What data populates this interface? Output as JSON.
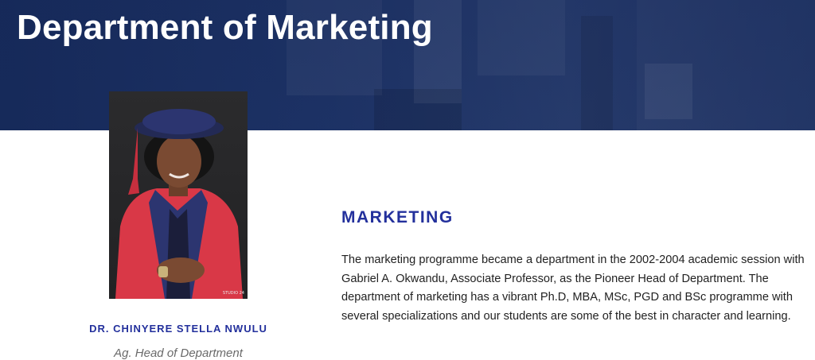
{
  "hero": {
    "title": "Department of Marketing"
  },
  "profile": {
    "name": "DR. CHINYERE STELLA NWULU",
    "role": "Ag. Head of Department",
    "photo_watermark": "STUDIO 24"
  },
  "content": {
    "heading": "MARKETING",
    "body": "The marketing programme became a department in the 2002-2004 academic session with Gabriel A. Okwandu, Associate Professor, as the Pioneer Head of Department. The department of marketing has a vibrant Ph.D, MBA, MSc, PGD and BSc programme with several specializations and our students are some of the best in character and learning."
  },
  "colors": {
    "hero_bg": "#1e3468",
    "heading_blue": "#23309c",
    "gown_red": "#d93847",
    "gown_navy": "#2c3570"
  }
}
